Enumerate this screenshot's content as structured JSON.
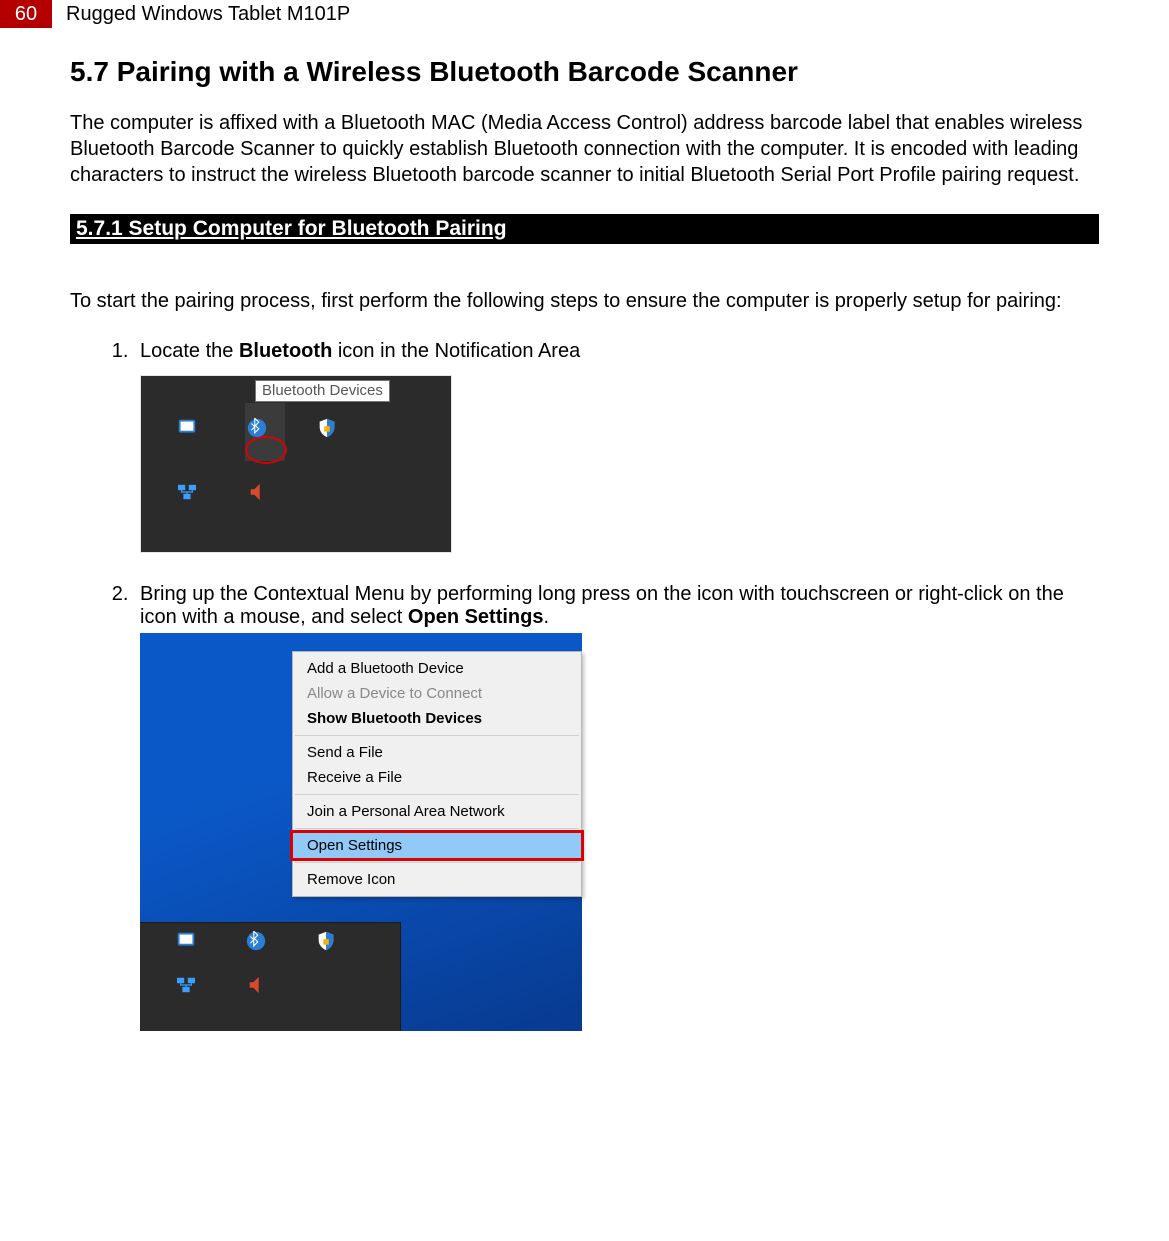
{
  "header": {
    "page_number": "60",
    "doc_title": "Rugged Windows Tablet M101P"
  },
  "section": {
    "title": "5.7 Pairing with a Wireless Bluetooth Barcode Scanner",
    "intro": "The computer is affixed with a Bluetooth MAC (Media Access Control) address barcode label that enables wireless Bluetooth Barcode Scanner to quickly establish Bluetooth connection with the computer. It is encoded with leading characters to instruct the wireless Bluetooth barcode scanner to initial Bluetooth Serial Port Profile pairing request."
  },
  "subsection": {
    "heading": "5.7.1 Setup Computer for Bluetooth Pairing",
    "lead": "To start the pairing process, first perform the following steps to ensure the computer is properly setup for pairing:"
  },
  "steps": {
    "s1_before": "Locate the ",
    "s1_bold": "Bluetooth",
    "s1_after": " icon in the Notification Area",
    "s2_before": "Bring up the Contextual Menu by performing long press on the icon with touchscreen or right-click on the icon with a mouse, and select ",
    "s2_bold": "Open Settings",
    "s2_after": "."
  },
  "shot1": {
    "tooltip": "Bluetooth Devices"
  },
  "context_menu": {
    "items": [
      {
        "label": "Add a Bluetooth Device",
        "style": "normal"
      },
      {
        "label": "Allow a Device to Connect",
        "style": "gray"
      },
      {
        "label": "Show Bluetooth Devices",
        "style": "bold"
      },
      {
        "sep": true
      },
      {
        "label": "Send a File",
        "style": "normal"
      },
      {
        "label": "Receive a File",
        "style": "normal"
      },
      {
        "sep": true
      },
      {
        "label": "Join a Personal Area Network",
        "style": "normal"
      },
      {
        "sep": true
      },
      {
        "label": "Open Settings",
        "style": "highlight"
      },
      {
        "sep": true
      },
      {
        "label": "Remove Icon",
        "style": "normal"
      }
    ]
  }
}
